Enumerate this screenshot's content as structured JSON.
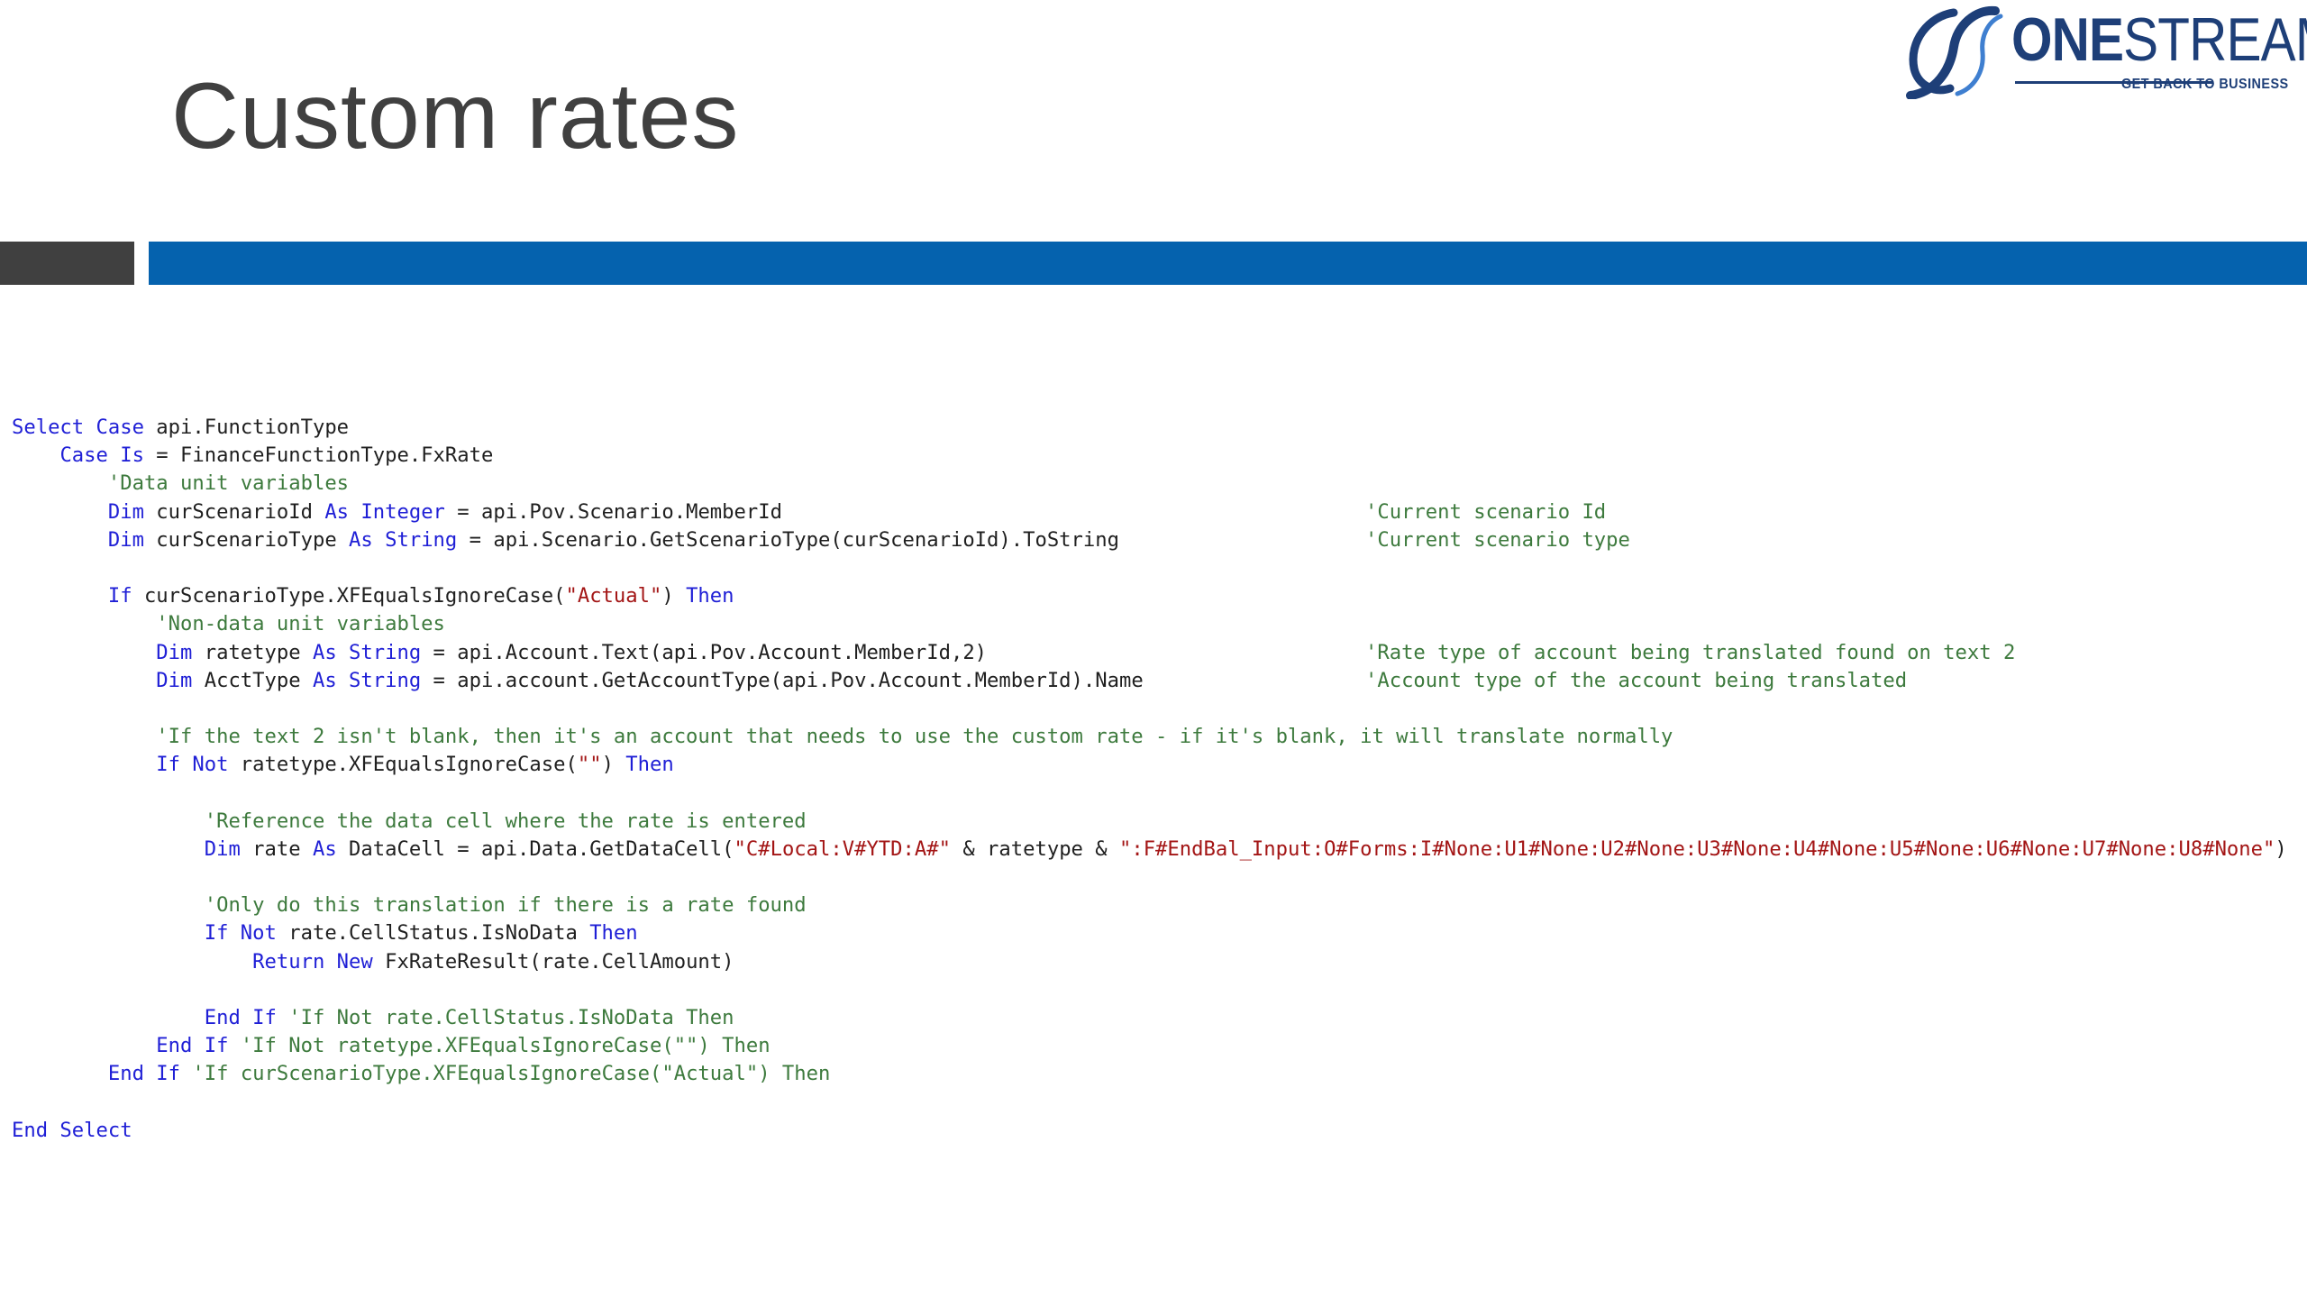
{
  "slide": {
    "title": "Custom rates"
  },
  "logo": {
    "word_bold": "ONE",
    "word_regular": "STREAM",
    "tagline": "GET BACK TO BUSINESS"
  },
  "colors": {
    "title": "#404040",
    "bar_dark": "#404040",
    "bar_blue": "#0562ae",
    "logo": "#1e3f78",
    "code_keyword": "#1f1fd6",
    "code_comment": "#3d7a3d",
    "code_string": "#a31515",
    "code_text": "#1f1f1f"
  },
  "code": {
    "lines": [
      {
        "indent": "",
        "tokens": [
          {
            "t": "kw",
            "v": "Select Case"
          },
          {
            "t": "pl",
            "v": " api.FunctionType"
          }
        ]
      },
      {
        "indent": "    ",
        "tokens": [
          {
            "t": "kw",
            "v": "Case Is"
          },
          {
            "t": "pl",
            "v": " = FinanceFunctionType.FxRate"
          }
        ]
      },
      {
        "indent": "        ",
        "tokens": [
          {
            "t": "cm",
            "v": "'Data unit variables"
          }
        ]
      },
      {
        "indent": "        ",
        "tokens": [
          {
            "t": "kw",
            "v": "Dim"
          },
          {
            "t": "pl",
            "v": " curScenarioId "
          },
          {
            "t": "kw",
            "v": "As Integer"
          },
          {
            "t": "pl",
            "v": " = api.Pov.Scenario.MemberId"
          }
        ],
        "comment": "'Current scenario Id"
      },
      {
        "indent": "        ",
        "tokens": [
          {
            "t": "kw",
            "v": "Dim"
          },
          {
            "t": "pl",
            "v": " curScenarioType "
          },
          {
            "t": "kw",
            "v": "As String"
          },
          {
            "t": "pl",
            "v": " = api.Scenario.GetScenarioType(curScenarioId).ToString"
          }
        ],
        "comment": "'Current scenario type"
      },
      {
        "indent": "",
        "tokens": []
      },
      {
        "indent": "        ",
        "tokens": [
          {
            "t": "kw",
            "v": "If"
          },
          {
            "t": "pl",
            "v": " curScenarioType.XFEqualsIgnoreCase("
          },
          {
            "t": "st",
            "v": "\"Actual\""
          },
          {
            "t": "pl",
            "v": ") "
          },
          {
            "t": "kw",
            "v": "Then"
          }
        ]
      },
      {
        "indent": "            ",
        "tokens": [
          {
            "t": "cm",
            "v": "'Non-data unit variables"
          }
        ]
      },
      {
        "indent": "            ",
        "tokens": [
          {
            "t": "kw",
            "v": "Dim"
          },
          {
            "t": "pl",
            "v": " ratetype "
          },
          {
            "t": "kw",
            "v": "As String"
          },
          {
            "t": "pl",
            "v": " = api.Account.Text(api.Pov.Account.MemberId,2)"
          }
        ],
        "comment": "'Rate type of account being translated found on text 2"
      },
      {
        "indent": "            ",
        "tokens": [
          {
            "t": "kw",
            "v": "Dim"
          },
          {
            "t": "pl",
            "v": " AcctType "
          },
          {
            "t": "kw",
            "v": "As String"
          },
          {
            "t": "pl",
            "v": " = api.account.GetAccountType(api.Pov.Account.MemberId).Name"
          }
        ],
        "comment": "'Account type of the account being translated"
      },
      {
        "indent": "",
        "tokens": []
      },
      {
        "indent": "            ",
        "tokens": [
          {
            "t": "cm",
            "v": "'If the text 2 isn't blank, then it's an account that needs to use the custom rate - if it's blank, it will translate normally"
          }
        ]
      },
      {
        "indent": "            ",
        "tokens": [
          {
            "t": "kw",
            "v": "If Not"
          },
          {
            "t": "pl",
            "v": " ratetype.XFEqualsIgnoreCase("
          },
          {
            "t": "st",
            "v": "\"\""
          },
          {
            "t": "pl",
            "v": ") "
          },
          {
            "t": "kw",
            "v": "Then"
          }
        ]
      },
      {
        "indent": "",
        "tokens": []
      },
      {
        "indent": "                ",
        "tokens": [
          {
            "t": "cm",
            "v": "'Reference the data cell where the rate is entered"
          }
        ]
      },
      {
        "indent": "                ",
        "tokens": [
          {
            "t": "kw",
            "v": "Dim"
          },
          {
            "t": "pl",
            "v": " rate "
          },
          {
            "t": "kw",
            "v": "As"
          },
          {
            "t": "pl",
            "v": " DataCell = api.Data.GetDataCell("
          },
          {
            "t": "st",
            "v": "\"C#Local:V#YTD:A#\""
          },
          {
            "t": "pl",
            "v": " & ratetype & "
          },
          {
            "t": "st",
            "v": "\":F#EndBal_Input:O#Forms:I#None:U1#None:U2#None:U3#None:U4#None:U5#None:U6#None:U7#None:U8#None\""
          },
          {
            "t": "pl",
            "v": ")"
          }
        ]
      },
      {
        "indent": "",
        "tokens": []
      },
      {
        "indent": "                ",
        "tokens": [
          {
            "t": "cm",
            "v": "'Only do this translation if there is a rate found"
          }
        ]
      },
      {
        "indent": "                ",
        "tokens": [
          {
            "t": "kw",
            "v": "If Not"
          },
          {
            "t": "pl",
            "v": " rate.CellStatus.IsNoData "
          },
          {
            "t": "kw",
            "v": "Then"
          }
        ]
      },
      {
        "indent": "                    ",
        "tokens": [
          {
            "t": "kw",
            "v": "Return New"
          },
          {
            "t": "pl",
            "v": " FxRateResult(rate.CellAmount)"
          }
        ]
      },
      {
        "indent": "",
        "tokens": []
      },
      {
        "indent": "                ",
        "tokens": [
          {
            "t": "kw",
            "v": "End If"
          },
          {
            "t": "pl",
            "v": " "
          },
          {
            "t": "cm",
            "v": "'If Not rate.CellStatus.IsNoData Then"
          }
        ]
      },
      {
        "indent": "            ",
        "tokens": [
          {
            "t": "kw",
            "v": "End If"
          },
          {
            "t": "pl",
            "v": " "
          },
          {
            "t": "cm",
            "v": "'If Not ratetype.XFEqualsIgnoreCase(\"\") Then"
          }
        ]
      },
      {
        "indent": "        ",
        "tokens": [
          {
            "t": "kw",
            "v": "End If"
          },
          {
            "t": "pl",
            "v": " "
          },
          {
            "t": "cm",
            "v": "'If curScenarioType.XFEqualsIgnoreCase(\"Actual\") Then"
          }
        ]
      },
      {
        "indent": "",
        "tokens": []
      },
      {
        "indent": "",
        "tokens": [
          {
            "t": "kw",
            "v": "End Select"
          }
        ]
      }
    ]
  }
}
